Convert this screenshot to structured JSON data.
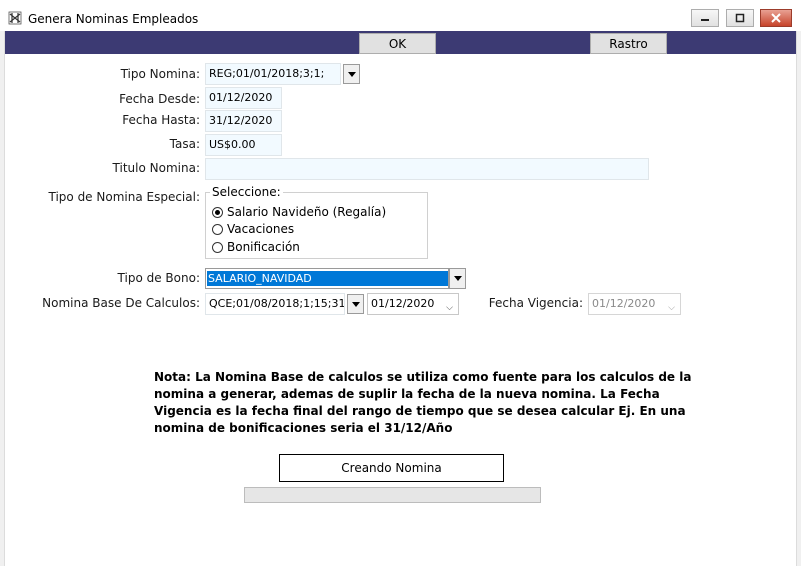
{
  "window": {
    "title": "Genera Nominas Empleados",
    "icon": "app-icon",
    "controls": [
      "minimize-icon",
      "maximize-icon",
      "close-icon"
    ]
  },
  "toolbar": {
    "ok_label": "OK",
    "rastro_label": "Rastro"
  },
  "form": {
    "tipo_nomina": {
      "label": "Tipo Nomina:",
      "value": "REG;01/01/2018;3;1;"
    },
    "fecha_desde": {
      "label": "Fecha Desde:",
      "value": "01/12/2020"
    },
    "fecha_hasta": {
      "label": "Fecha Hasta:",
      "value": "31/12/2020"
    },
    "tasa": {
      "label": "Tasa:",
      "value": "US$0.00"
    },
    "titulo_nomina": {
      "label": "Titulo Nomina:",
      "value": ""
    },
    "tipo_especial": {
      "label": "Tipo de Nomina Especial:",
      "group_title": "Seleccione:",
      "options": [
        {
          "label": "Salario Navideño (Regalía)",
          "selected": true
        },
        {
          "label": "Vacaciones",
          "selected": false
        },
        {
          "label": "Bonificación",
          "selected": false
        }
      ]
    },
    "tipo_bono": {
      "label": "Tipo de Bono:",
      "value": "SALARIO_NAVIDAD"
    },
    "nomina_base": {
      "label": "Nomina Base De Calculos:",
      "value": "QCE;01/08/2018;1;15;31",
      "date": "01/12/2020"
    },
    "fecha_vigencia": {
      "label": "Fecha Vigencia:",
      "value": "01/12/2020"
    }
  },
  "note": "Nota: La Nomina Base de calculos se utiliza como fuente para los calculos de la nomina a generar, ademas de suplir la fecha de la nueva nomina. La Fecha Vigencia es la fecha final del rango de tiempo que se desea calcular Ej. En una nomina de bonificaciones seria el 31/12/Año",
  "status": {
    "text": "Creando Nomina",
    "progress": 0
  },
  "colors": {
    "toolbar_bg": "#3c3a73",
    "field_bg": "#f2faff",
    "selection_bg": "#0078d7"
  }
}
